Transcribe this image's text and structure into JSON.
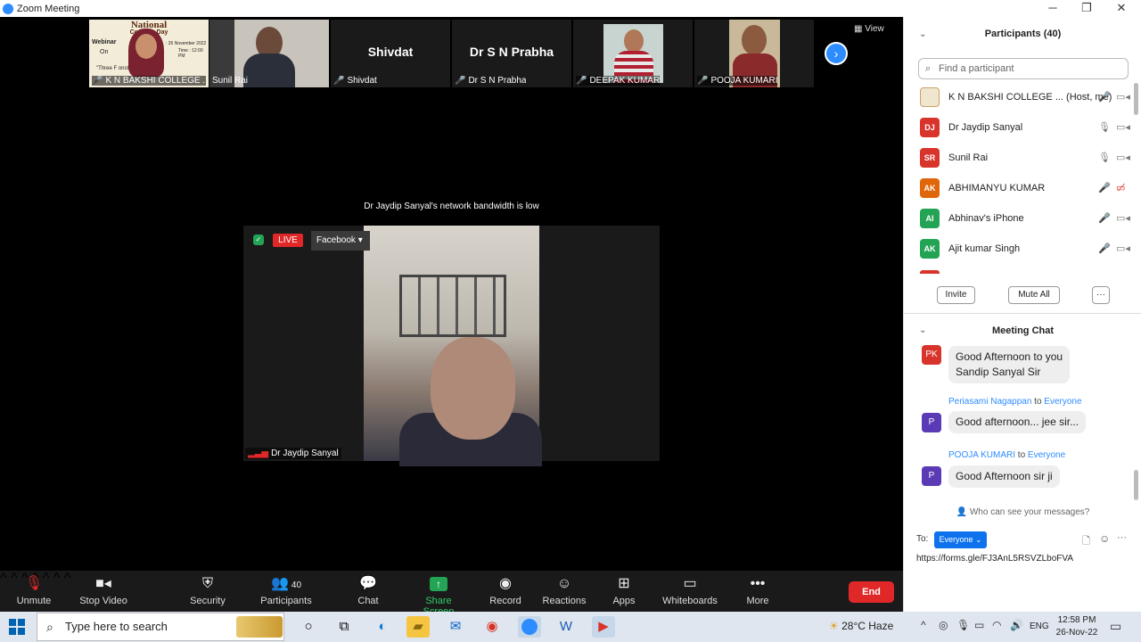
{
  "window": {
    "title": "Zoom Meeting",
    "minimize": "─",
    "maximize": "❐",
    "close": "✕"
  },
  "gallery": {
    "view_label": "View",
    "thumbs": [
      {
        "name": "K N BAKSHI COLLEGE ...",
        "muted": true,
        "text": ""
      },
      {
        "name": "Sunil Rai",
        "muted": false,
        "text": ""
      },
      {
        "name": "Shivdat",
        "muted": true,
        "text": "Shivdat"
      },
      {
        "name": "Dr  S  N  Prabha",
        "muted": true,
        "text": "Dr  S  N  Prabha"
      },
      {
        "name": "DEEPAK KUMAR",
        "muted": true,
        "text": ""
      },
      {
        "name": "POOJA KUMARI",
        "muted": true,
        "text": ""
      }
    ],
    "poster": {
      "line1": "National",
      "line2": "Cons       on Day",
      "line3": "Webinar",
      "line4": "On",
      "line5": "\"Three F            onstitution",
      "date": ": 26 November 2022",
      "time": "Time : 12:00 PM"
    }
  },
  "main": {
    "notice": "Dr Jaydip Sanyal's network bandwidth is low",
    "live_label": "LIVE",
    "facebook_label": "Facebook",
    "speaker_name": "Dr Jaydip Sanyal"
  },
  "toolbar": {
    "unmute": "Unmute",
    "stop_video": "Stop Video",
    "security": "Security",
    "participants": "Participants",
    "participants_count": "40",
    "chat": "Chat",
    "share_screen": "Share Screen",
    "record": "Record",
    "reactions": "Reactions",
    "apps": "Apps",
    "whiteboards": "Whiteboards",
    "more": "More",
    "end": "End"
  },
  "participants_panel": {
    "title": "Participants (40)",
    "search_placeholder": "Find a participant",
    "rows": [
      {
        "initials": "",
        "name": "K N BAKSHI COLLEGE ... (Host, me)",
        "color": "#f0e6d0",
        "mic": "muted",
        "video": "on"
      },
      {
        "initials": "DJ",
        "name": "Dr Jaydip Sanyal",
        "color": "#d9342b",
        "mic": "on",
        "video": "on"
      },
      {
        "initials": "SR",
        "name": "Sunil Rai",
        "color": "#d9342b",
        "mic": "on",
        "video": "on"
      },
      {
        "initials": "AK",
        "name": "ABHIMANYU KUMAR",
        "color": "#e0660b",
        "mic": "muted",
        "video": "off"
      },
      {
        "initials": "AI",
        "name": "Abhinav's iPhone",
        "color": "#23a455",
        "mic": "muted",
        "video": "on"
      },
      {
        "initials": "AK",
        "name": "Ajit kumar Singh",
        "color": "#23a455",
        "mic": "muted",
        "video": "on"
      }
    ],
    "invite": "Invite",
    "mute_all": "Mute All",
    "more": "···"
  },
  "chat": {
    "title": "Meeting Chat",
    "messages": [
      {
        "initials": "PK",
        "color": "#d9342b",
        "sender": "",
        "to": "",
        "line1": "Good Afternoon to you",
        "line2": "Sandip Sanyal Sir"
      },
      {
        "initials": "P",
        "color": "#5a3ab5",
        "sender": "Periasami Nagappan",
        "to": "Everyone",
        "line1": "Good afternoon... jee sir...",
        "line2": ""
      },
      {
        "initials": "P",
        "color": "#5a3ab5",
        "sender": "POOJA KUMARI",
        "to": "Everyone",
        "line1": "Good Afternoon sir ji",
        "line2": ""
      }
    ],
    "to_word": "to",
    "who_can_see": "Who can see your messages?",
    "to_label": "To:",
    "to_value": "Everyone",
    "input_text": "https://forms.gle/FJ3AnL5RSVZLboFVA"
  },
  "taskbar": {
    "search_placeholder": "Type here to search",
    "weather": "28°C  Haze",
    "lang": "ENG",
    "time": "12:58 PM",
    "date": "26-Nov-22"
  }
}
